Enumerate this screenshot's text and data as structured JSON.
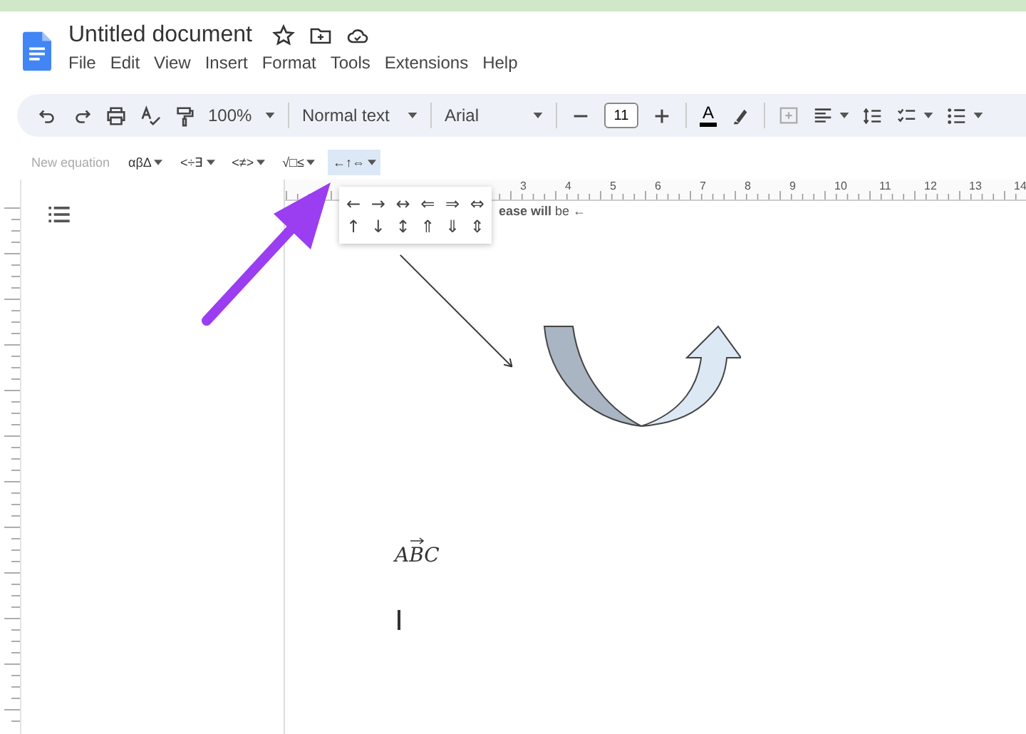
{
  "document": {
    "title": "Untitled document"
  },
  "menu": [
    "File",
    "Edit",
    "View",
    "Insert",
    "Format",
    "Tools",
    "Extensions",
    "Help"
  ],
  "toolbar": {
    "zoom": "100%",
    "style": "Normal text",
    "font": "Arial",
    "font_size": "11",
    "text_color_label": "A"
  },
  "equation_bar": {
    "label": "New equation",
    "groups": [
      {
        "label": "αβΔ",
        "selected": false
      },
      {
        "label": "<÷∃",
        "selected": false
      },
      {
        "label": "<≠>",
        "selected": false
      },
      {
        "label": "√□≤",
        "selected": false
      },
      {
        "label": "←↑⇔",
        "selected": true
      }
    ]
  },
  "arrow_menu": {
    "rows": [
      [
        "←",
        "→",
        "↔",
        "⇐",
        "⇒",
        "⇔"
      ],
      [
        "↑",
        "↓",
        "↕",
        "⇑",
        "⇓",
        "⇕"
      ]
    ]
  },
  "ruler": {
    "marks": [
      "3",
      "4",
      "5",
      "6",
      "7",
      "8",
      "9",
      "10",
      "11",
      "12",
      "13",
      "14"
    ]
  },
  "page": {
    "text": "**ease will** be ←",
    "equation": "ABC"
  }
}
